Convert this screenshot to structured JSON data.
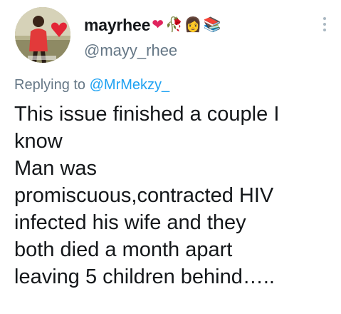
{
  "tweet": {
    "display_name": "mayrhee",
    "name_emojis": [
      "❤",
      "🥀",
      "👩",
      "📚"
    ],
    "handle": "@mayy_rhee",
    "reply_prefix": "Replying to",
    "reply_mention": "@MrMekzy_",
    "text": "This issue finished a couple I\nknow\nMan was\npromiscuous,contracted HIV\ninfected his wife and they\nboth died a month apart\nleaving 5 children behind….."
  },
  "colors": {
    "text": "#14171a",
    "secondary": "#657786",
    "link": "#1da1f2",
    "heart": "#e0245e"
  },
  "icons": {
    "more": "vertical-ellipsis-icon"
  }
}
